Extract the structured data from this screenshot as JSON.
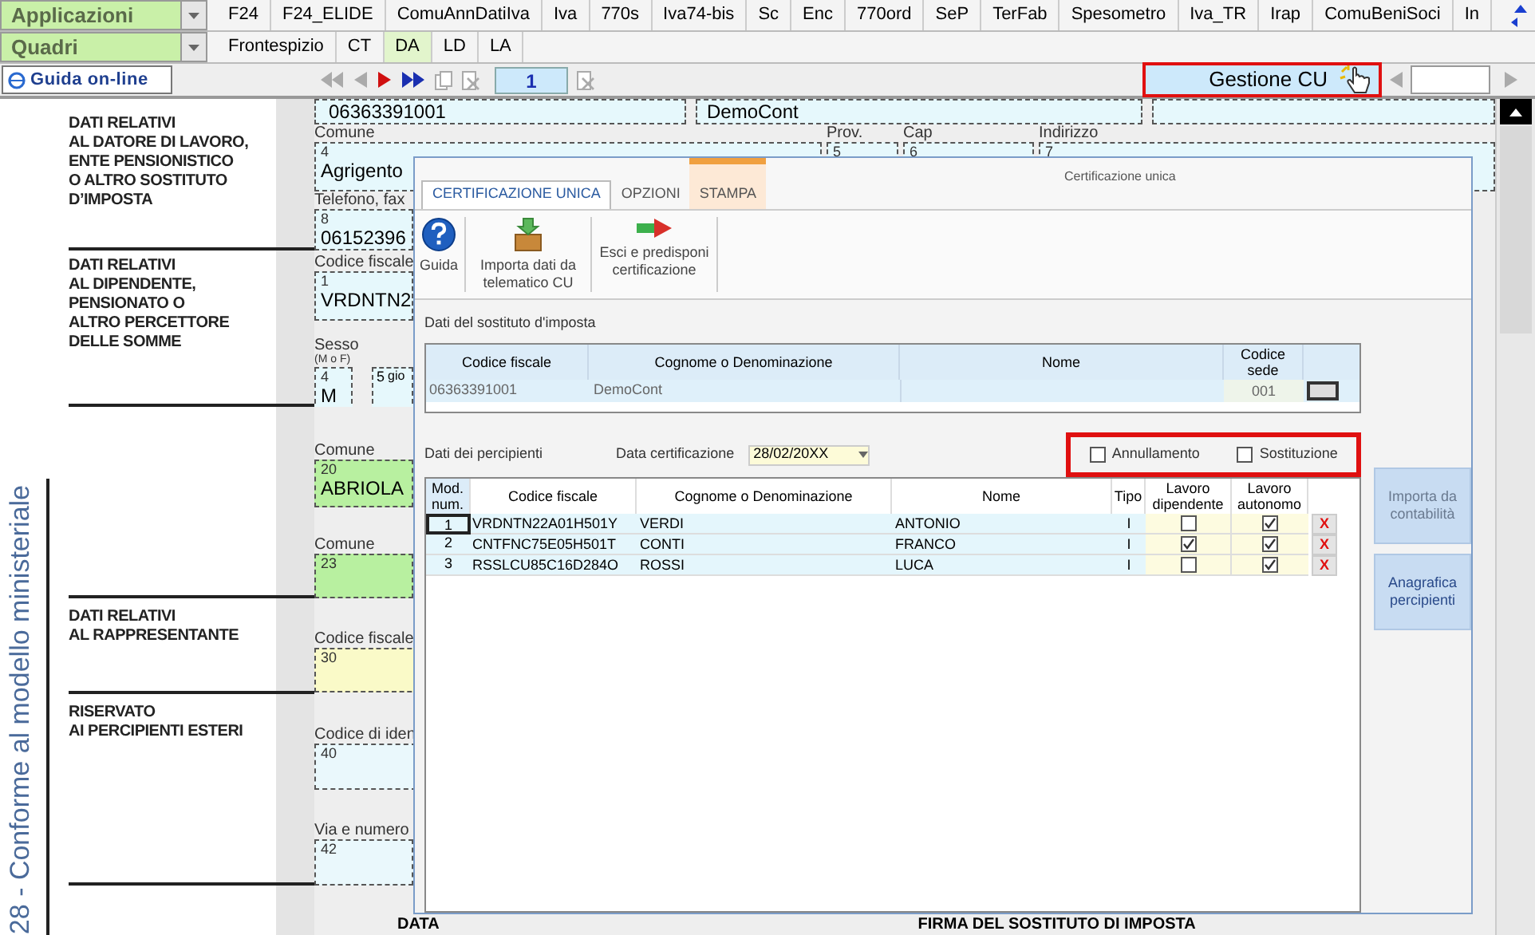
{
  "top_bar": {
    "applications": "Applicazioni",
    "sections": "Quadri",
    "app_tabs": [
      {
        "label": "F24",
        "selected": false
      },
      {
        "label": "F24_ELIDE",
        "selected": false
      },
      {
        "label": "ComuAnnDatiIva",
        "selected": false
      },
      {
        "label": "Iva",
        "selected": false
      },
      {
        "label": "770s",
        "selected": false
      },
      {
        "label": "Iva74-bis",
        "selected": false
      },
      {
        "label": "Sc",
        "selected": false
      },
      {
        "label": "Enc",
        "selected": false
      },
      {
        "label": "770ord",
        "selected": false
      },
      {
        "label": "SeP",
        "selected": false
      },
      {
        "label": "TerFab",
        "selected": false
      },
      {
        "label": "Spesometro",
        "selected": false
      },
      {
        "label": "Iva_TR",
        "selected": false
      },
      {
        "label": "Irap",
        "selected": false
      },
      {
        "label": "ComuBeniSoci",
        "selected": false
      },
      {
        "label": "In",
        "selected": false
      }
    ],
    "section_tabs": [
      {
        "label": "Frontespizio",
        "selected": false
      },
      {
        "label": "CT",
        "selected": false
      },
      {
        "label": "DA",
        "selected": true
      },
      {
        "label": "LD",
        "selected": false
      },
      {
        "label": "LA",
        "selected": false
      }
    ]
  },
  "toolbar": {
    "help_button": "Guida on-line",
    "page": "1",
    "manage_button": {
      "label": "Gestione CU",
      "highlighted": true
    }
  },
  "form": {
    "side_note": "28 - Conforme al modello ministeriale",
    "employer": {
      "label_lines": [
        "DATI RELATIVI",
        "AL DATORE DI LAVORO,",
        "ENTE PENSIONISTICO",
        "O ALTRO SOSTITUTO",
        "D’IMPOSTA"
      ],
      "tax_code": "06363391001",
      "name": "DemoCont",
      "city": {
        "caption": "Comune",
        "number": "4",
        "value": "Agrigento"
      },
      "province": {
        "caption": "Prov.",
        "number": "5"
      },
      "zip": {
        "caption": "Cap",
        "number": "6"
      },
      "address": {
        "caption": "Indirizzo",
        "number": "7"
      },
      "phone": {
        "caption": "Telefono, fax",
        "number": "8",
        "value": "06152396"
      }
    },
    "employee": {
      "label_lines": [
        "DATI RELATIVI",
        "AL DIPENDENTE,",
        "PENSIONATO O",
        "ALTRO PERCETTORE",
        "DELLE SOMME"
      ],
      "tax_code": {
        "caption": "Codice fiscale",
        "number": "1",
        "value": "VRDNTN2"
      },
      "sex": {
        "caption": "Sesso",
        "hint": "(M o F)",
        "number": "4",
        "value": "M"
      },
      "birth": {
        "number": "5",
        "note": "gio"
      },
      "birth_city": {
        "caption": "Comune",
        "number": "20",
        "value": "ABRIOLA"
      },
      "city": {
        "caption": "Comune",
        "number": "23"
      }
    },
    "representative": {
      "label_lines": [
        "DATI RELATIVI",
        "AL RAPPRESENTANTE"
      ],
      "tax_code": {
        "caption": "Codice fiscale",
        "number": "30"
      }
    },
    "foreign": {
      "label_lines": [
        "RISERVATO",
        "AI PERCIPIENTI ESTERI"
      ],
      "id_code": {
        "caption": "Codice di iden",
        "number": "40"
      },
      "street": {
        "caption": "Via e numero",
        "number": "42"
      }
    },
    "footer": {
      "date": "DATA",
      "signature": "FIRMA DEL SOSTITUTO DI IMPOSTA"
    }
  },
  "dialog": {
    "title": "Certificazione unica",
    "tabs": [
      {
        "label": "CERTIFICAZIONE UNICA",
        "selected": true,
        "highlighted": false
      },
      {
        "label": "OPZIONI",
        "selected": false,
        "highlighted": false
      },
      {
        "label": "STAMPA",
        "selected": false,
        "highlighted": true
      }
    ],
    "ribbon": [
      {
        "kind": "help",
        "label": "Guida"
      },
      {
        "kind": "import",
        "label": "Importa dati da telematico CU"
      },
      {
        "kind": "exit",
        "label": "Esci e predisponi certificazione"
      }
    ],
    "withholder": {
      "title": "Dati del sostituto d'imposta",
      "columns": [
        "Codice fiscale",
        "Cognome o Denominazione",
        "Nome",
        "Codice sede"
      ],
      "row": {
        "tax_code": "06363391001",
        "name": "DemoCont",
        "office": "001"
      }
    },
    "recipients_title": "Dati dei percipienti",
    "date_label": "Data certificazione",
    "date": "28/02/20XX",
    "options": {
      "highlighted": true,
      "items": [
        {
          "label": "Annullamento",
          "checked": false
        },
        {
          "label": "Sostituzione",
          "checked": false
        }
      ]
    },
    "columns": [
      "Mod. num.",
      "Codice fiscale",
      "Cognome o Denominazione",
      "Nome",
      "Tipo",
      "Lavoro dipendente",
      "Lavoro autonomo"
    ],
    "rows": [
      {
        "num": "1",
        "tax_code": "VRDNTN22A01H501Y",
        "surname": "VERDI",
        "name": "ANTONIO",
        "type": "I",
        "employee": false,
        "self_employed": true,
        "delete": "X",
        "selected": true
      },
      {
        "num": "2",
        "tax_code": "CNTFNC75E05H501T",
        "surname": "CONTI",
        "name": "FRANCO",
        "type": "I",
        "employee": true,
        "self_employed": true,
        "delete": "X",
        "selected": false
      },
      {
        "num": "3",
        "tax_code": "RSSLCU85C16D284O",
        "surname": "ROSSI",
        "name": "LUCA",
        "type": "I",
        "employee": false,
        "self_employed": true,
        "delete": "X",
        "selected": false
      }
    ],
    "side_buttons": [
      {
        "label": "Importa da contabilità",
        "disabled": true
      },
      {
        "label": "Anagrafica percipienti",
        "disabled": false
      }
    ]
  }
}
